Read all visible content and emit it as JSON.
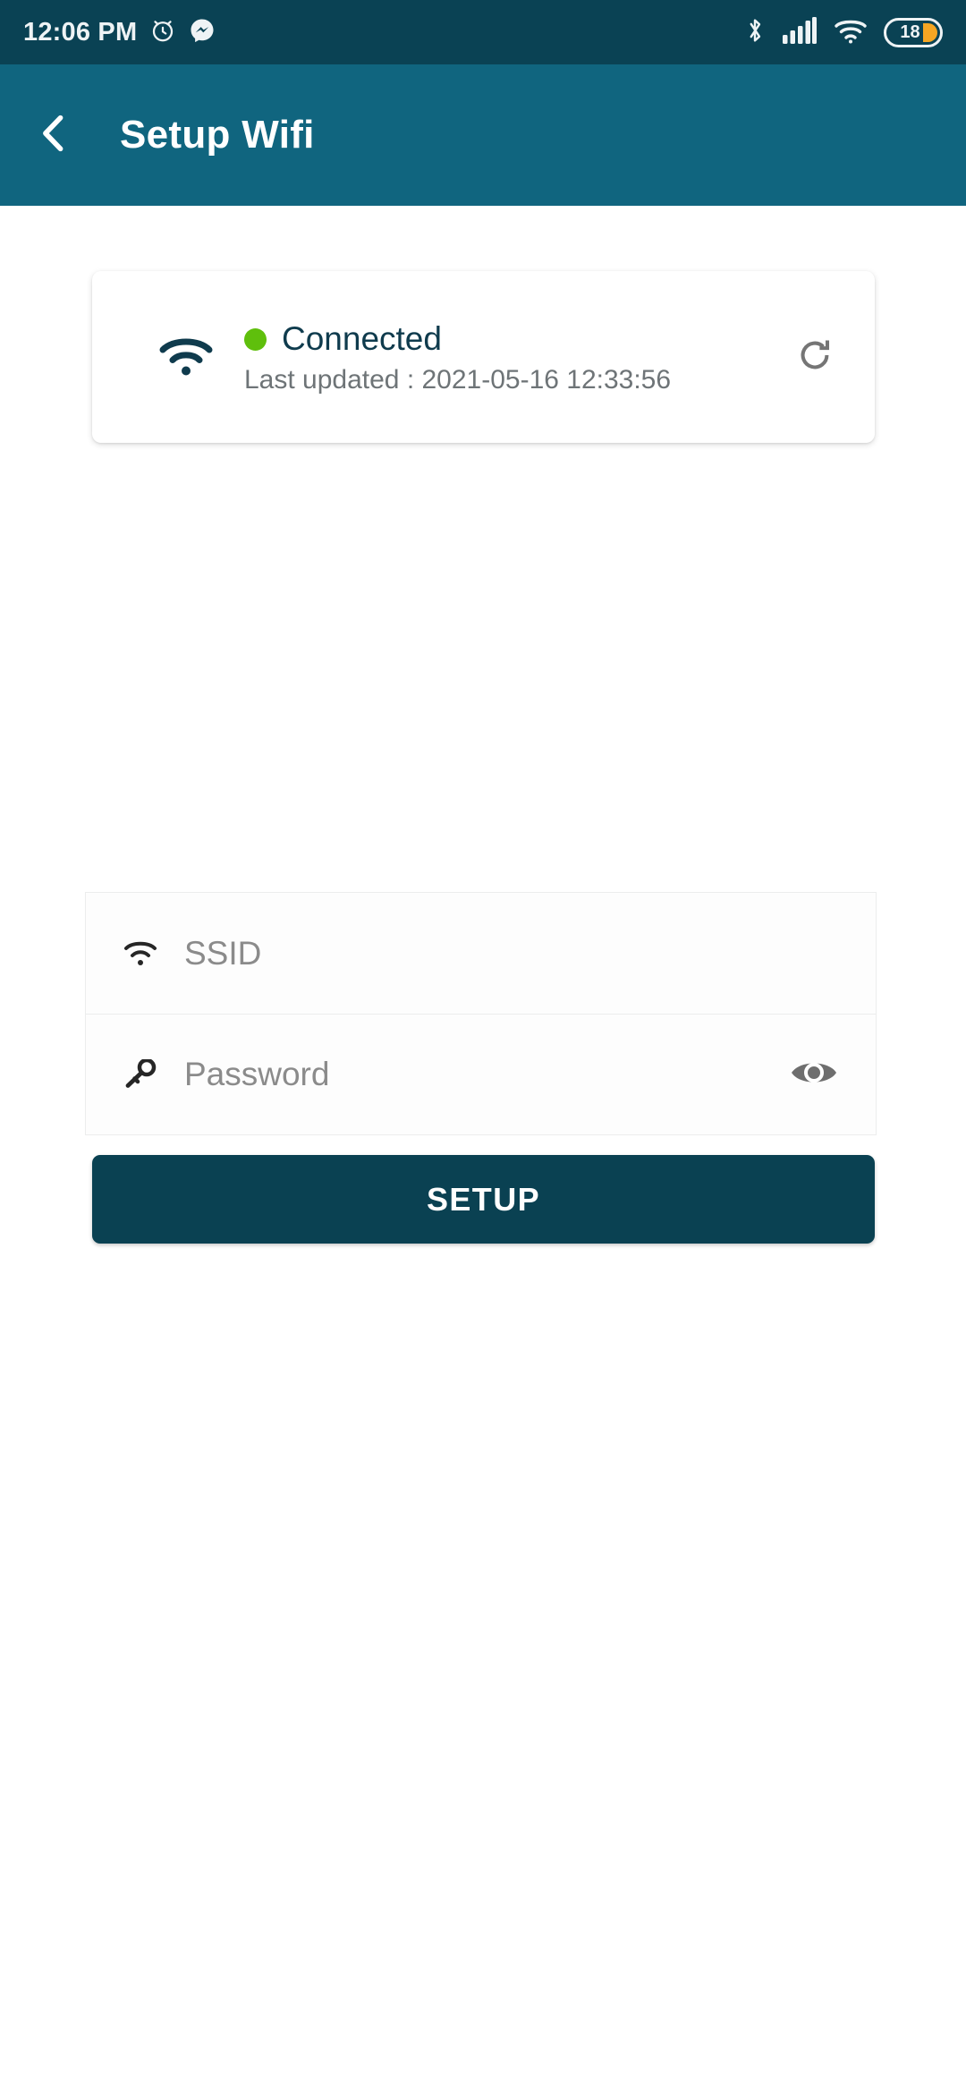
{
  "status_bar": {
    "time": "12:06 PM",
    "icons_left": [
      "alarm-clock-icon",
      "messenger-icon"
    ],
    "icons_right": [
      "bluetooth-icon",
      "cellular-signal-icon",
      "wifi-icon",
      "battery-icon"
    ],
    "battery_level": "18",
    "background_color": "#0a4254",
    "battery_fill_color": "#f5a623"
  },
  "app_bar": {
    "title": "Setup Wifi",
    "back_icon": "chevron-left-icon",
    "background_color": "#10657f"
  },
  "status_card": {
    "wifi_icon": "wifi-icon",
    "status_text": "Connected",
    "status_dot_color": "#5fbf0c",
    "status_text_color": "#0f3b4d",
    "last_updated": "Last updated : 2021-05-16 12:33:56",
    "refresh_icon": "refresh-icon"
  },
  "form": {
    "ssid": {
      "icon": "wifi-icon",
      "placeholder": "SSID",
      "value": ""
    },
    "password": {
      "icon": "key-icon",
      "placeholder": "Password",
      "value": "",
      "toggle_icon": "eye-icon"
    },
    "submit_label": "SETUP",
    "submit_color": "#0a4152"
  }
}
